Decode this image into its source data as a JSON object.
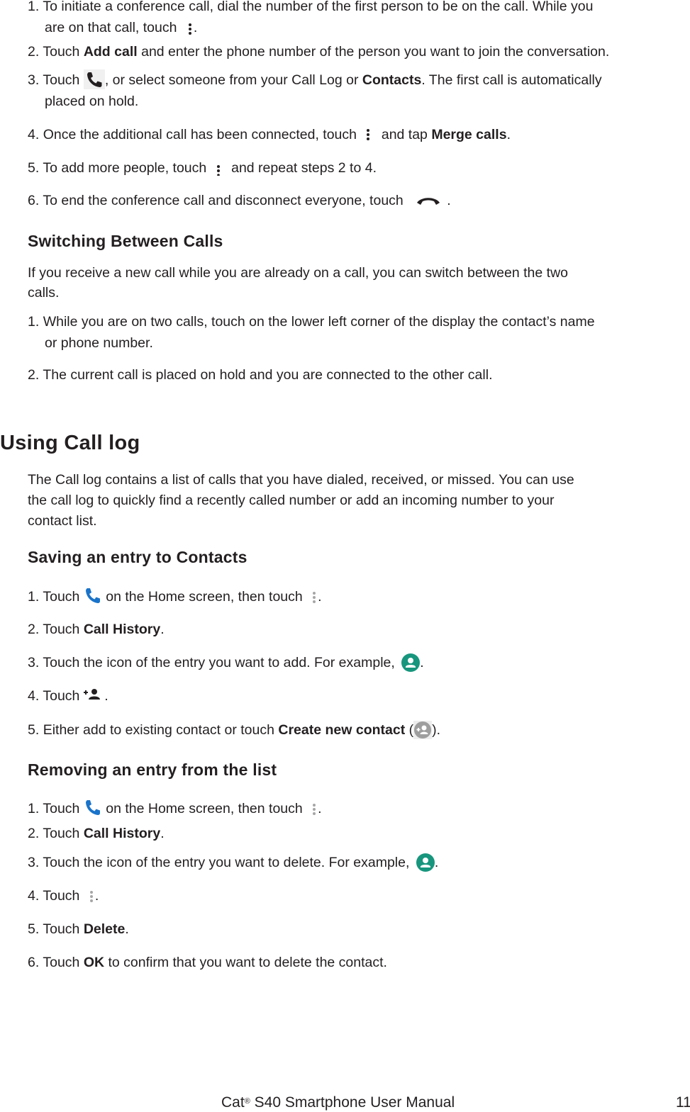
{
  "conference_steps": [
    {
      "num": "1.",
      "pre": "To initiate a conference call, dial the number of the first person to be on the call. While you",
      "cont_pre": "are on that call, touch",
      "icon": "more-vert-icon",
      "post": "."
    },
    {
      "num": "2.",
      "pre": "Touch",
      "bold": "Add call",
      "post": "and enter the phone number of the person you want to join the conversation."
    },
    {
      "num": "3.",
      "pre": "Touch",
      "icon": "phone-icon",
      "post": ", or select someone from your Call Log or",
      "bold": "Contacts",
      "post2": ". The first call is automatically",
      "cont": "placed on hold."
    },
    {
      "num": "4.",
      "pre": "Once the additional call has been connected, touch",
      "icon": "more-vert-icon",
      "mid": "and tap",
      "bold": "Merge calls",
      "post": "."
    },
    {
      "num": "5.",
      "pre": "To add more people, touch",
      "icon": "more-vert-icon",
      "post": "and repeat steps 2 to 4."
    },
    {
      "num": "6.",
      "pre": "To end the conference call and disconnect everyone, touch",
      "icon": "end-call-icon",
      "post": "."
    }
  ],
  "switching": {
    "heading": "Switching Between Calls",
    "intro_1": "If you receive a new call while you are already on a call, you can switch between the two",
    "intro_2": "calls.",
    "steps": [
      {
        "num": "1.",
        "text": "While you are on two calls, touch on the lower left corner of the display the contact’s name",
        "cont": "or phone number."
      },
      {
        "num": "2.",
        "text": "The current call is placed on hold and you are connected to the other call."
      }
    ]
  },
  "call_log": {
    "heading": "Using Call log",
    "intro_1": "The Call log contains a list of calls that you have dialed, received, or missed. You can use",
    "intro_2": "the call log to quickly find a recently called number or add an incoming number to your",
    "intro_3": "contact list."
  },
  "saving": {
    "heading": "Saving an entry to Contacts",
    "steps": [
      {
        "num": "1.",
        "pre": "Touch",
        "icon": "phone-app-icon",
        "post": "on the Home screen, then touch",
        "icon2": "more-vert-icon",
        "post2": "."
      },
      {
        "num": "2.",
        "pre": "Touch",
        "bold": "Call History",
        "post": "."
      },
      {
        "num": "3.",
        "pre": "Touch the icon of the entry you want to add. For example,",
        "icon": "contact-avatar-icon",
        "post": "."
      },
      {
        "num": "4.",
        "pre": "Touch",
        "icon": "add-person-icon",
        "post": "."
      },
      {
        "num": "5.",
        "pre": "Either add to existing contact or touch",
        "bold": "Create new contact",
        "post_open": "(",
        "icon": "create-contact-icon",
        "post": ")."
      }
    ]
  },
  "removing": {
    "heading": "Removing an entry from the list",
    "steps": [
      {
        "num": "1.",
        "pre": "Touch",
        "icon": "phone-app-icon",
        "post": "on the Home screen, then touch",
        "icon2": "more-vert-icon",
        "post2": "."
      },
      {
        "num": "2.",
        "pre": "Touch",
        "bold": "Call History",
        "post": "."
      },
      {
        "num": "3.",
        "pre": "Touch the icon of the entry you want to delete. For example,",
        "icon": "contact-avatar-icon",
        "post": "."
      },
      {
        "num": "4.",
        "pre": "Touch",
        "icon": "more-vert-icon",
        "post": "."
      },
      {
        "num": "5.",
        "pre": "Touch",
        "bold": "Delete",
        "post": "."
      },
      {
        "num": "6.",
        "pre": "Touch",
        "bold": "OK",
        "post": "to confirm that you want to delete the contact."
      }
    ]
  },
  "footer": {
    "brand": "Cat",
    "reg": "®",
    "title_rest": "S40 Smartphone User Manual",
    "page_number": "11"
  },
  "colors": {
    "text": "#231f20",
    "phone_blue": "#1a73c9",
    "avatar_teal": "#17967d",
    "kebab_gray": "#a6a6a6",
    "create_contact_gray": "#9e9e9e"
  }
}
